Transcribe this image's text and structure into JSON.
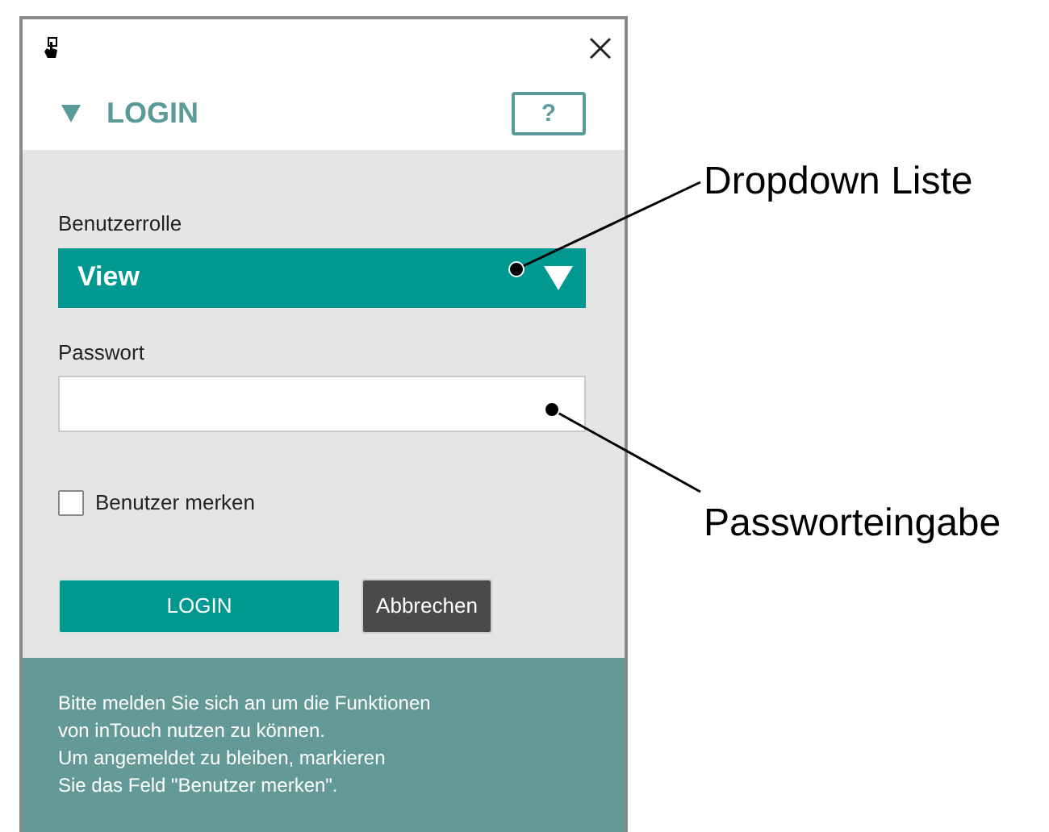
{
  "header": {
    "title": "LOGIN",
    "help_label": "?"
  },
  "form": {
    "role_label": "Benutzerrolle",
    "role_value": "View",
    "password_label": "Passwort",
    "remember": {
      "label": "Benutzer merken",
      "checked": false
    },
    "buttons": [
      {
        "label": "LOGIN",
        "kind": "primary"
      },
      {
        "label": "Abbrechen",
        "kind": "secondary"
      }
    ]
  },
  "info_lines": [
    "Bitte melden Sie sich an um die Funktionen",
    "von inTouch nutzen zu können.",
    "Um angemeldet zu bleiben, markieren",
    "Sie das Feld \"Benutzer merken\"."
  ],
  "annotations": [
    {
      "label": "Dropdown Liste"
    },
    {
      "label": "Passworteingabe"
    }
  ]
}
